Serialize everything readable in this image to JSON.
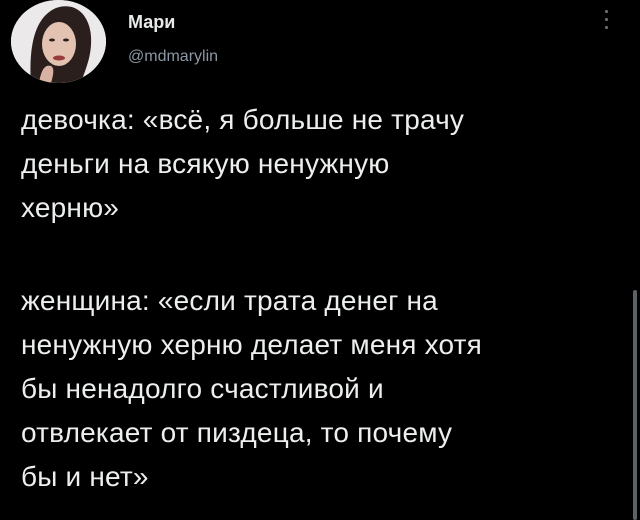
{
  "tweet": {
    "author": {
      "display_name": "Мари",
      "handle": "@mdmarylin"
    },
    "avatar_icon": "avatar-photo",
    "more_icon": "more-vertical-icon",
    "paragraphs": [
      "девочка: «всё, я больше не трачу\nденьги на всякую ненужную\nхерню»",
      "женщина: «если трата денег на\nненужную херню делает меня хотя\nбы ненадолго счастливой и\nотвлекает от пиздеца, то почему\nбы и нет»"
    ]
  },
  "colors": {
    "background": "#000000",
    "text": "#eceeef",
    "handle": "#8b98a5",
    "scrollbar": "#5c6166"
  }
}
